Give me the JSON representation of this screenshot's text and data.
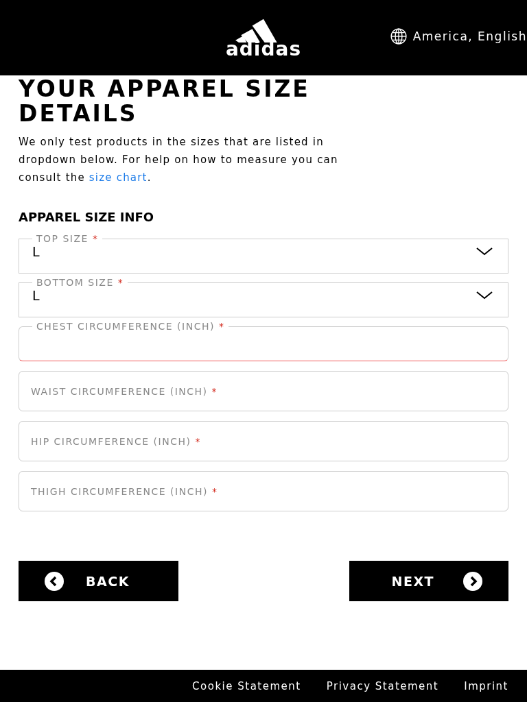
{
  "header": {
    "logo": "adidas",
    "locale": "America, English"
  },
  "title": "YOUR APPAREL SIZE DETAILS",
  "intro": {
    "text": "We only test products in the sizes that are listed in dropdown below. For help on how to measure you can consult the ",
    "link": "size chart",
    "after": "."
  },
  "section_title": "APPAREL SIZE INFO",
  "fields": [
    {
      "kind": "select",
      "label": "TOP SIZE",
      "required_mark": "*",
      "value": "L",
      "invalid": false
    },
    {
      "kind": "select",
      "label": "BOTTOM SIZE",
      "required_mark": "*",
      "value": "L",
      "invalid": false
    },
    {
      "kind": "text-floating",
      "label": "CHEST CIRCUMFERENCE (INCH)",
      "required_mark": "*",
      "invalid": true
    },
    {
      "kind": "text",
      "label": "WAIST CIRCUMFERENCE (INCH)",
      "required_mark": "*",
      "invalid": false
    },
    {
      "kind": "text",
      "label": "HIP CIRCUMFERENCE (INCH)",
      "required_mark": "*",
      "invalid": false
    },
    {
      "kind": "text",
      "label": "THIGH CIRCUMFERENCE (INCH)",
      "required_mark": "*",
      "invalid": false
    }
  ],
  "buttons": {
    "back": "BACK",
    "next": "NEXT"
  },
  "footer": [
    "Cookie Statement",
    "Privacy Statement",
    "Imprint"
  ]
}
